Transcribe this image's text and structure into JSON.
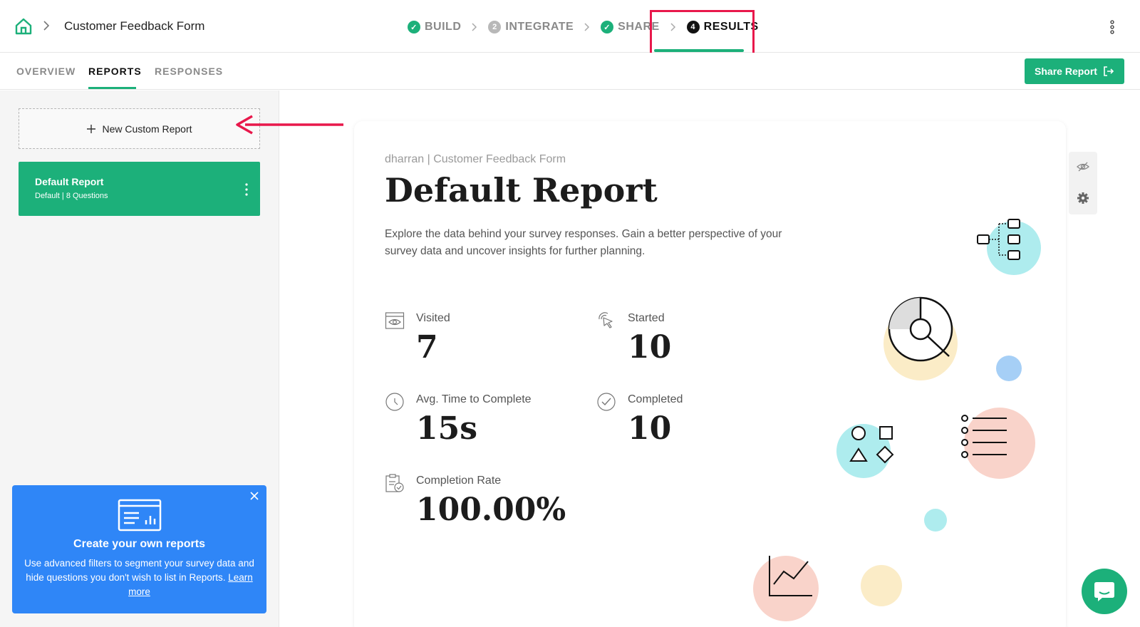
{
  "header": {
    "form_title": "Customer Feedback Form",
    "steps": [
      {
        "label": "BUILD",
        "badge": "✓",
        "state": "done"
      },
      {
        "label": "INTEGRATE",
        "badge": "2",
        "state": "pending"
      },
      {
        "label": "SHARE",
        "badge": "✓",
        "state": "done"
      },
      {
        "label": "RESULTS",
        "badge": "4",
        "state": "active"
      }
    ]
  },
  "subnav": {
    "tabs": [
      "OVERVIEW",
      "REPORTS",
      "RESPONSES"
    ],
    "active_tab": "REPORTS",
    "share_label": "Share Report"
  },
  "sidebar": {
    "new_report_label": "New Custom Report",
    "default_report": {
      "title": "Default Report",
      "subtitle": "Default  |  8 Questions"
    },
    "promo": {
      "title": "Create your own reports",
      "body": "Use advanced filters to segment your survey data and hide questions you don't wish to list in Reports.",
      "link": "Learn more"
    }
  },
  "report": {
    "meta": "dharran  |  Customer Feedback Form",
    "title": "Default Report",
    "description": "Explore the data behind your survey responses. Gain a better perspective of your survey data and uncover insights for further planning.",
    "stats": [
      {
        "label": "Visited",
        "value": "7",
        "icon": "browser-eye-icon"
      },
      {
        "label": "Started",
        "value": "10",
        "icon": "cursor-click-icon"
      },
      {
        "label": "Avg. Time to Complete",
        "value": "15s",
        "icon": "clock-icon"
      },
      {
        "label": "Completed",
        "value": "10",
        "icon": "check-circle-icon"
      },
      {
        "label": "Completion Rate",
        "value": "100.00%",
        "icon": "clipboard-check-icon"
      }
    ]
  },
  "colors": {
    "accent": "#1cb07a",
    "promo": "#2f86f7",
    "highlight": "#e8184b"
  }
}
